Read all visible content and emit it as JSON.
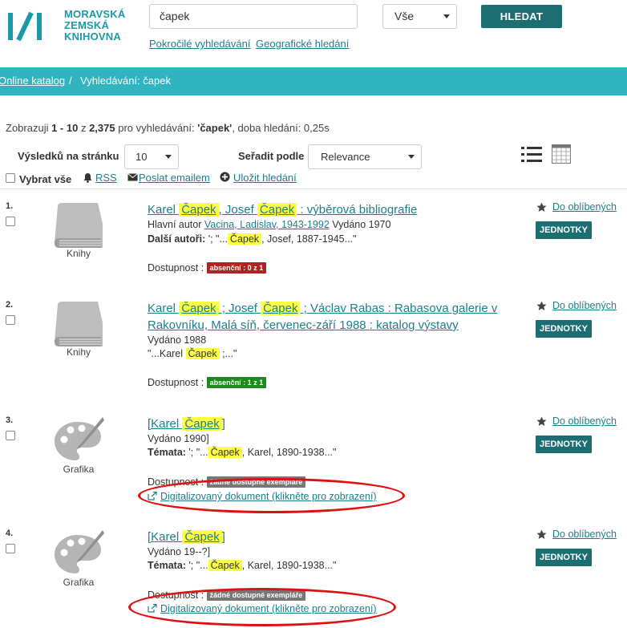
{
  "header": {
    "logo_lines": [
      "MORAVSKÁ",
      "ZEMSKÁ",
      "KNIHOVNA"
    ],
    "search_value": "čapek",
    "scope_value": "Vše",
    "search_button": "HLEDAT",
    "advanced_link": "Pokročilé vyhledávání",
    "geo_link": "Geografické hledání"
  },
  "breadcrumb": {
    "home": "Online katalog",
    "separator": "/",
    "current": "Vyhledávání: čapek"
  },
  "summary": {
    "prefix": "Zobrazuji ",
    "range": "1 - 10",
    "of": " z ",
    "total": "2,375",
    "middle": " pro vyhledávání: ",
    "query": "'čapek'",
    "suffix": ", doba hledání: 0,25s"
  },
  "controls": {
    "per_page_label": "Výsledků na stránku",
    "per_page_value": "10",
    "sort_label": "Seřadit podle",
    "sort_value": "Relevance",
    "select_all": "Vybrat vše",
    "rss": "RSS",
    "email": "Poslat emailem",
    "save_search": "Uložit hledání"
  },
  "common": {
    "availability_label": "Dostupnost :",
    "favorites": "Do oblíbených",
    "units_button": "JEDNOTKY",
    "digital_link": "Digitalizovaný dokument (klikněte pro zobrazení)",
    "topics_label": "Témata:",
    "other_authors_label": "Další autoři:"
  },
  "results": [
    {
      "number": "1.",
      "format": "Knihy",
      "title": [
        "Karel ",
        "Čapek",
        ", Josef ",
        "Čapek",
        " : výběrová bibliografie"
      ],
      "author_prefix": "Hlavní autor ",
      "author": "Vacina, Ladislav, 1943-1992",
      "published": " Vydáno 1970",
      "snippet_pre": " '; \"...",
      "snippet_hl": "Čapek",
      "snippet_post": ", Josef, 1887-1945...\"",
      "badge": "absenční : 0 z 1",
      "badge_color": "#b22222"
    },
    {
      "number": "2.",
      "format": "Knihy",
      "title_line1": [
        "Karel ",
        "Čapek",
        " ; Josef ",
        "Čapek",
        " ; Václav Rabas : Rabasova galerie v"
      ],
      "title_line2": "Rakovníku, Malá síň, červenec-září 1988 : katalog výstavy",
      "published": "Vydáno 1988",
      "snippet_pre": "\"...Karel ",
      "snippet_hl": "Čapek",
      "snippet_post": " ;...\"",
      "badge": "absenční : 1 z 1",
      "badge_color": "#1c8a1c"
    },
    {
      "number": "3.",
      "format": "Grafika",
      "title": [
        "[Karel ",
        "Čapek",
        "]"
      ],
      "published": "Vydáno 1990]",
      "snippet_pre": " '; \"...",
      "snippet_hl": "Čapek",
      "snippet_post": ", Karel, 1890-1938...\"",
      "badge": "žádné dostupné exempláře",
      "badge_color": "#777777"
    },
    {
      "number": "4.",
      "format": "Grafika",
      "title": [
        "[Karel ",
        "Čapek",
        "]"
      ],
      "published": "Vydáno 19--?]",
      "snippet_pre": " '; \"...",
      "snippet_hl": "Čapek",
      "snippet_post": ", Karel, 1890-1938...\"",
      "badge": "žádné dostupné exempláře",
      "badge_color": "#777777"
    }
  ],
  "colors": {
    "accent": "#2fb4c0",
    "button": "#1c6e73",
    "link": "#1f7e8c",
    "highlight": "#ffff44",
    "annotation": "#e01010"
  }
}
